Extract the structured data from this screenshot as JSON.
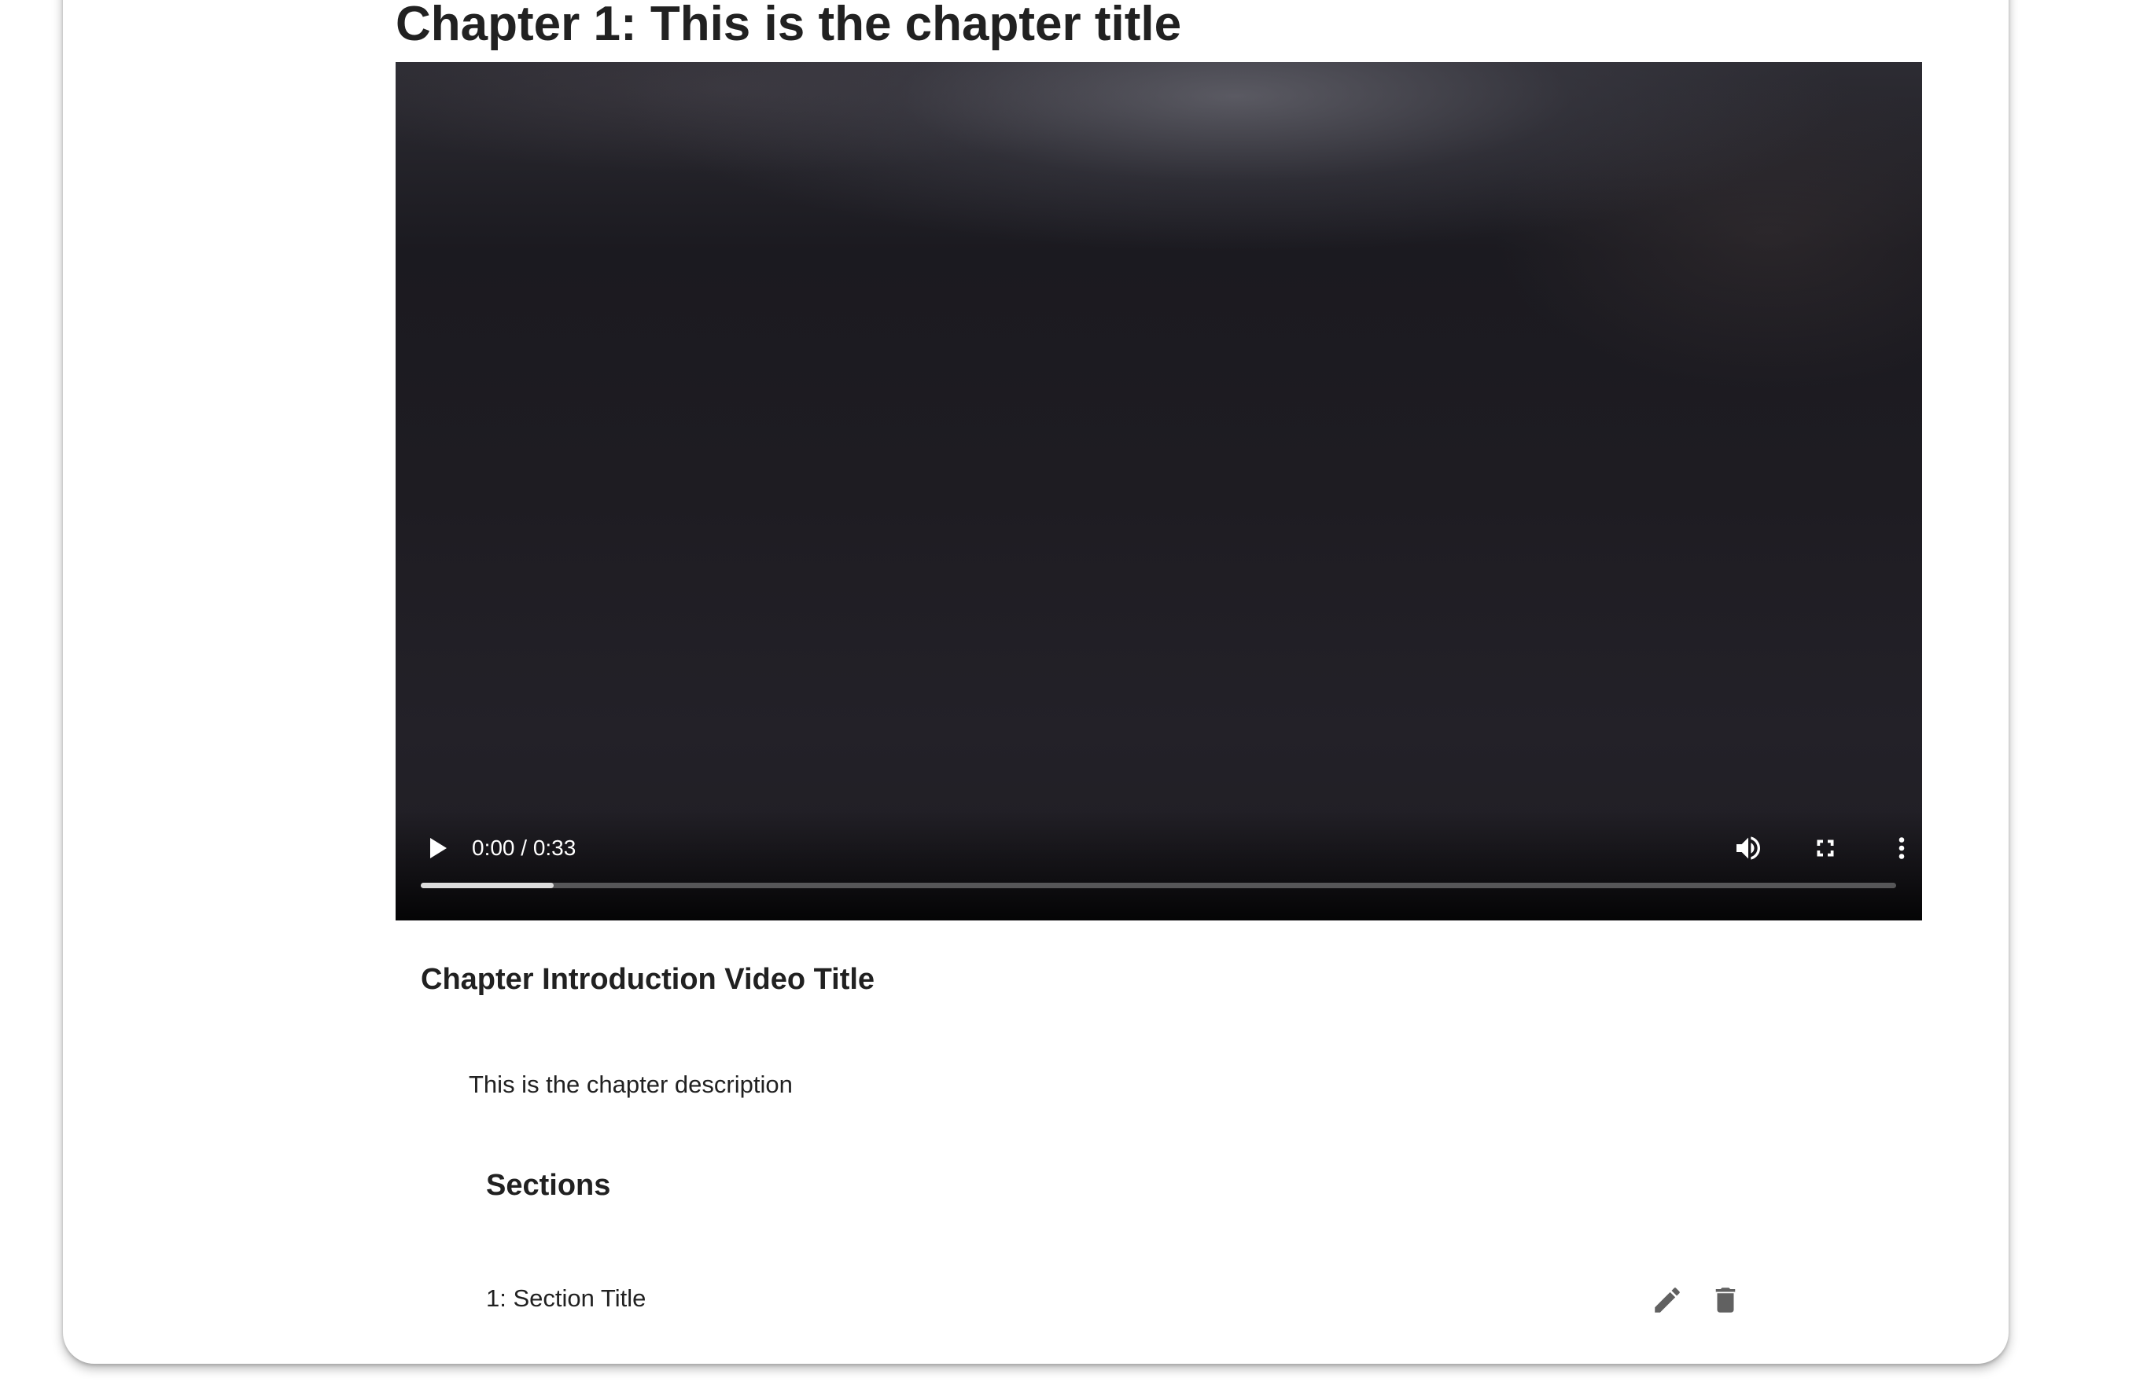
{
  "chapter": {
    "title": "Chapter 1: This is the chapter title",
    "video_title": "Chapter Introduction Video Title",
    "description": "This is the chapter description"
  },
  "video": {
    "time_display": "0:00 / 0:33",
    "buffered_fraction": 0.09,
    "icons": {
      "play": "play-icon",
      "volume": "volume-icon",
      "fullscreen": "fullscreen-icon",
      "more": "more-vert-icon"
    }
  },
  "sections": {
    "heading": "Sections",
    "items": [
      {
        "label": "1: Section Title",
        "edit_icon": "edit-icon",
        "delete_icon": "delete-icon"
      }
    ]
  },
  "colors": {
    "text": "#212121",
    "icon": "#616161",
    "video_bg": "#1c1a20",
    "control_icon": "#ffffff"
  }
}
